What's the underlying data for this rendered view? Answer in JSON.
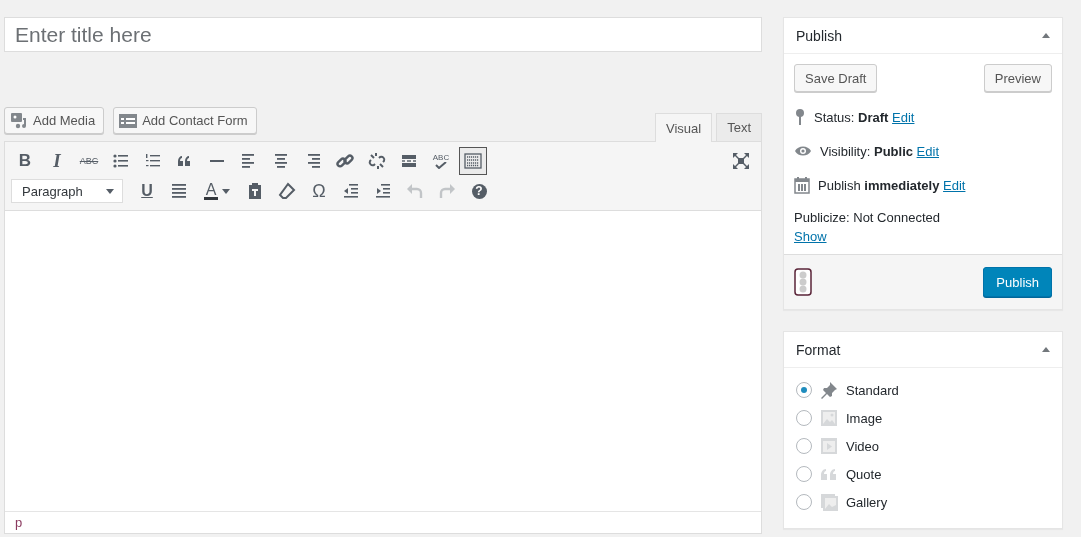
{
  "title_field": {
    "placeholder": "Enter title here"
  },
  "media_buttons": [
    {
      "kind": "media",
      "label": "Add Media"
    },
    {
      "kind": "form",
      "label": "Add Contact Form"
    }
  ],
  "editor_tabs": [
    {
      "label": "Visual",
      "selected": true
    },
    {
      "label": "Text",
      "selected": false
    }
  ],
  "toolbar_row_1": [
    {
      "kind": "bold",
      "glyph": "B",
      "active": false,
      "disabled": false
    },
    {
      "kind": "italic",
      "glyph": "I",
      "active": false,
      "disabled": false
    },
    {
      "kind": "strike",
      "glyph": "ABC",
      "active": false,
      "disabled": false
    },
    {
      "kind": "bullets",
      "active": false,
      "disabled": false
    },
    {
      "kind": "numbers",
      "active": false,
      "disabled": false
    },
    {
      "kind": "quote",
      "active": false,
      "disabled": false
    },
    {
      "kind": "hr",
      "active": false,
      "disabled": false
    },
    {
      "kind": "align-left",
      "active": false,
      "disabled": false
    },
    {
      "kind": "align-center",
      "active": false,
      "disabled": false
    },
    {
      "kind": "align-right",
      "active": false,
      "disabled": false
    },
    {
      "kind": "link",
      "active": false,
      "disabled": false
    },
    {
      "kind": "unlink",
      "active": false,
      "disabled": false
    },
    {
      "kind": "more",
      "active": false,
      "disabled": false
    },
    {
      "kind": "spell",
      "glyph": "ABC",
      "active": false,
      "disabled": false
    }
  ],
  "toolbar_toggle": {
    "pressed": true
  },
  "toolbar_row_2": [
    {
      "kind": "underline",
      "glyph": "U",
      "active": false,
      "disabled": false
    },
    {
      "kind": "justify",
      "active": false,
      "disabled": false
    },
    {
      "kind": "color",
      "glyph": "A",
      "active": false,
      "disabled": false
    },
    {
      "kind": "paste",
      "active": false,
      "disabled": false
    },
    {
      "kind": "eraser",
      "active": false,
      "disabled": false
    },
    {
      "kind": "omega",
      "glyph": "Ω",
      "active": false,
      "disabled": false
    },
    {
      "kind": "outdent",
      "active": false,
      "disabled": false
    },
    {
      "kind": "indent",
      "active": false,
      "disabled": false
    },
    {
      "kind": "undo",
      "active": false,
      "disabled": true
    },
    {
      "kind": "redo",
      "active": false,
      "disabled": true
    },
    {
      "kind": "help",
      "glyph": "?",
      "active": false,
      "disabled": false
    }
  ],
  "format_select": {
    "value": "Paragraph"
  },
  "status_path": "p",
  "publish_box": {
    "title": "Publish",
    "save_draft": "Save Draft",
    "preview": "Preview",
    "rows": [
      {
        "kind": "status",
        "label": "Status:",
        "value": "Draft",
        "link": "Edit"
      },
      {
        "kind": "visibility",
        "label": "Visibility:",
        "value": "Public",
        "link": "Edit"
      },
      {
        "kind": "schedule",
        "label": "Publish",
        "value": "immediately",
        "link": "Edit"
      }
    ],
    "publicize": "Publicize: Not Connected",
    "publicize_link": "Show",
    "publish_button": "Publish"
  },
  "format_box": {
    "title": "Format",
    "options": [
      {
        "kind": "standard",
        "label": "Standard",
        "selected": true
      },
      {
        "kind": "image",
        "label": "Image",
        "selected": false
      },
      {
        "kind": "video",
        "label": "Video",
        "selected": false
      },
      {
        "kind": "quote",
        "label": "Quote",
        "selected": false
      },
      {
        "kind": "gallery",
        "label": "Gallery",
        "selected": false
      }
    ]
  }
}
